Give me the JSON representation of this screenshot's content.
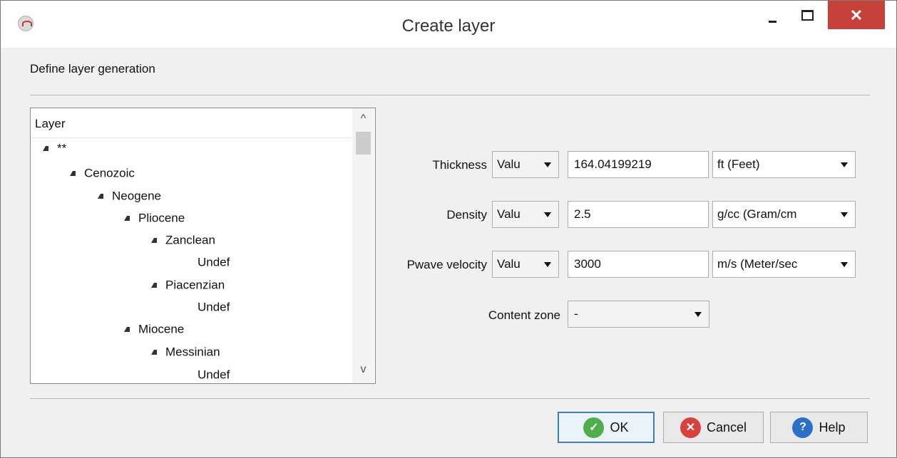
{
  "window": {
    "title": "Create layer",
    "close_glyph": "✕"
  },
  "section_label": "Define layer generation",
  "tree": {
    "header": "Layer",
    "nodes": [
      {
        "label": "**",
        "expanded": true
      },
      {
        "label": "Cenozoic",
        "expanded": true
      },
      {
        "label": "Neogene",
        "expanded": true
      },
      {
        "label": "Pliocene",
        "expanded": true
      },
      {
        "label": "Zanclean",
        "expanded": true
      },
      {
        "label": "Undef",
        "expanded": false
      },
      {
        "label": "Piacenzian",
        "expanded": true
      },
      {
        "label": "Undef",
        "expanded": false
      },
      {
        "label": "Miocene",
        "expanded": true
      },
      {
        "label": "Messinian",
        "expanded": true
      },
      {
        "label": "Undef",
        "expanded": false
      }
    ],
    "scroll_up": "^",
    "scroll_down": "v"
  },
  "fields": {
    "thickness": {
      "label": "Thickness",
      "mode": "Valu",
      "value": "164.04199219",
      "unit": "ft (Feet)"
    },
    "density": {
      "label": "Density",
      "mode": "Valu",
      "value": "2.5",
      "unit": "g/cc (Gram/cm"
    },
    "pwave": {
      "label": "Pwave velocity",
      "mode": "Valu",
      "value": "3000",
      "unit": "m/s (Meter/sec"
    },
    "content_zone": {
      "label": "Content zone",
      "value": "-"
    }
  },
  "buttons": {
    "ok": "OK",
    "cancel": "Cancel",
    "help": "Help",
    "ok_glyph": "✓",
    "cancel_glyph": "✕",
    "help_glyph": "?"
  },
  "icons": {
    "app": "app-logo-icon",
    "ok": "check-circle-icon",
    "cancel": "x-circle-icon",
    "help": "question-circle-icon"
  },
  "colors": {
    "close_button": "#c7413b",
    "ok_border": "#3c7fb1",
    "ok_icon": "#4fae4a",
    "cancel_icon": "#d9423b",
    "help_icon": "#2b6fc9"
  }
}
